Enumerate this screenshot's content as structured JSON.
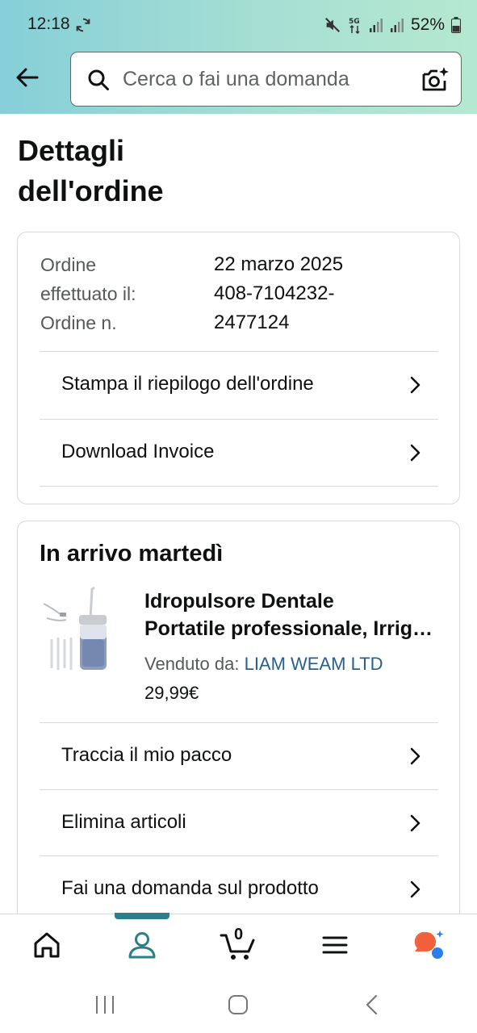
{
  "status": {
    "time": "12:18",
    "battery": "52%"
  },
  "search": {
    "placeholder": "Cerca o fai una domanda"
  },
  "page": {
    "title_line1": "Dettagli",
    "title_line2": "dell'ordine"
  },
  "order": {
    "label1": "Ordine",
    "label2": "effettuato il:",
    "label3": "Ordine n.",
    "date": "22 marzo 2025",
    "number_line1": "408-7104232-",
    "number_line2": "2477124"
  },
  "actions1": {
    "print": "Stampa il riepilogo dell'ordine",
    "invoice": "Download Invoice"
  },
  "shipment": {
    "title": "In arrivo martedì",
    "product_line1": "Idropulsore Dentale",
    "product_line2": "Portatile professionale, Irrigatore",
    "seller_label": "Venduto da:",
    "seller_name": "LIAM WEAM LTD",
    "price": "29,99€"
  },
  "actions2": {
    "track": "Traccia il mio pacco",
    "remove": "Elimina articoli",
    "ask": "Fai una domanda sul prodotto"
  },
  "nav": {
    "cart_count": "0"
  },
  "colors": {
    "accent": "#2a7f8a",
    "link": "#2a5f8a",
    "header_start": "#86cfd8",
    "header_end": "#b5e8d0"
  }
}
